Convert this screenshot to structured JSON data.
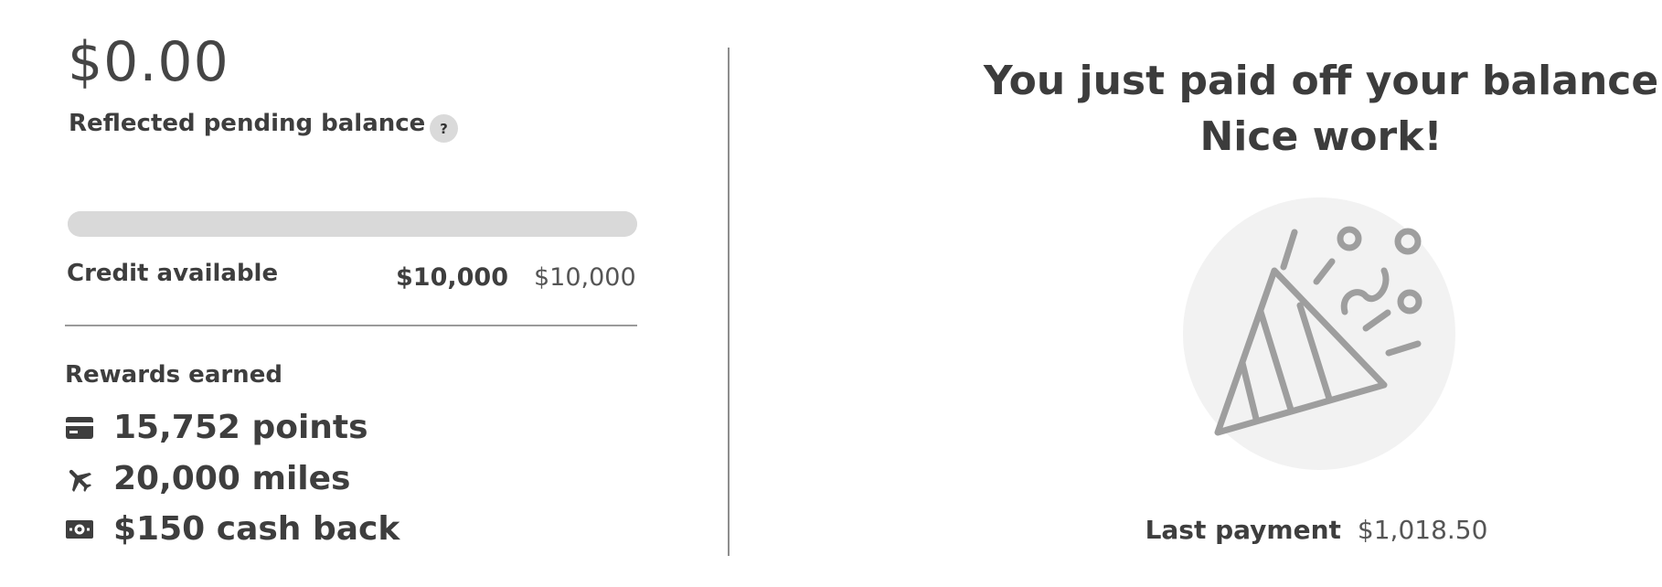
{
  "balance": {
    "amount": "$0.00",
    "pending_label": "Reflected pending balance",
    "help_label": "?"
  },
  "credit": {
    "bar_fill_fraction": 1.0,
    "bar_color": "#d9d9d9",
    "label": "Credit available",
    "available": "$10,000",
    "limit": "$10,000"
  },
  "rewards": {
    "heading": "Rewards earned",
    "items": [
      {
        "icon": "credit-card-icon",
        "text": "15,752 points"
      },
      {
        "icon": "airplane-icon",
        "text": "20,000 miles"
      },
      {
        "icon": "cash-icon",
        "text": "$150 cash back"
      }
    ]
  },
  "celebration": {
    "headline_line1": "You just paid off your balance",
    "headline_line2": "Nice work!",
    "illustration": "party-popper-icon",
    "circle_color": "#f2f2f2",
    "icon_color": "#9e9e9e"
  },
  "last_payment": {
    "label": "Last payment",
    "amount": "$1,018.50"
  }
}
